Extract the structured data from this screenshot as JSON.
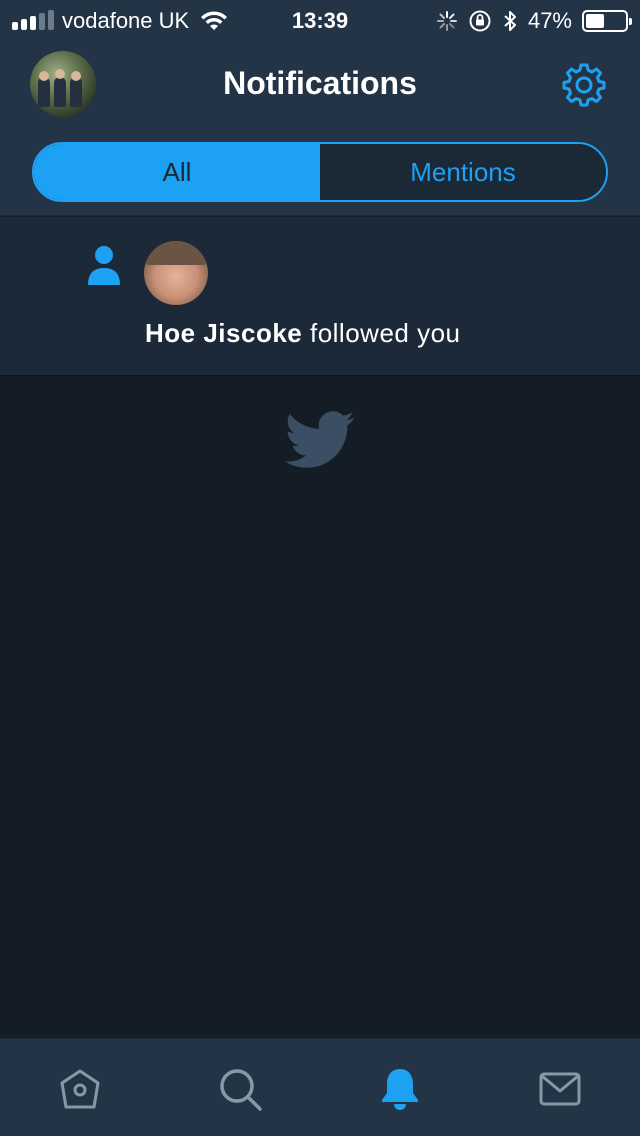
{
  "status_bar": {
    "carrier": "vodafone UK",
    "time": "13:39",
    "battery_percent": "47%",
    "battery_level": 0.47,
    "signal_bars_filled": 3,
    "signal_bars_total": 5
  },
  "header": {
    "title": "Notifications"
  },
  "tabs": [
    {
      "label": "All",
      "active": true
    },
    {
      "label": "Mentions",
      "active": false
    }
  ],
  "notification": {
    "user_name": "Hoe Jiscoke",
    "action_text": " followed you"
  },
  "tab_bar": {
    "items": [
      "home-icon",
      "search-icon",
      "notifications-icon",
      "messages-icon"
    ],
    "active": "notifications-icon"
  },
  "colors": {
    "accent": "#1da1f2",
    "background": "#141d26",
    "header": "#243447",
    "inactive_icon": "#8899a6"
  }
}
